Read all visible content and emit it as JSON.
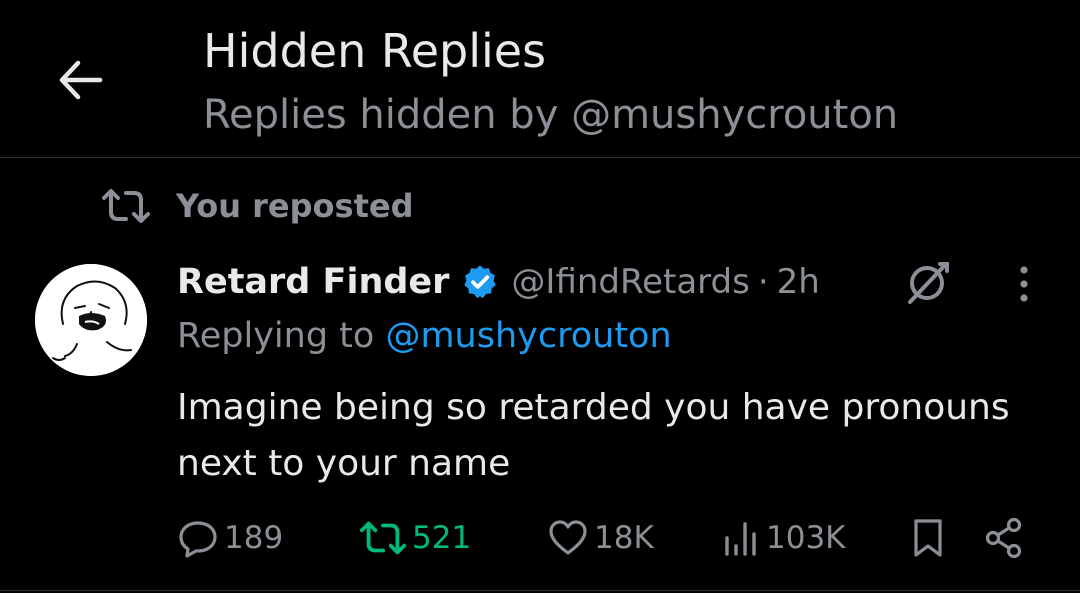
{
  "header": {
    "title": "Hidden Replies",
    "subtitle": "Replies hidden by @mushycrouton"
  },
  "repost_context": {
    "label": "You reposted"
  },
  "tweet": {
    "author_name": "Retard Finder",
    "handle": "@IfindRetards",
    "separator": "·",
    "time": "2h",
    "verified": true,
    "replying_prefix": "Replying to ",
    "replying_to": "@mushycrouton",
    "text": "Imagine being so retarded you have pronouns next to your name",
    "metrics": {
      "replies": "189",
      "reposts": "521",
      "likes": "18K",
      "views": "103K"
    }
  },
  "icons": {
    "back": "arrow-left-icon",
    "repost_context": "repost-icon",
    "verified": "verified-badge-icon",
    "grok": "grok-icon",
    "more": "more-vertical-icon",
    "reply": "reply-icon",
    "repost": "repost-icon",
    "like": "heart-icon",
    "views": "views-icon",
    "bookmark": "bookmark-icon",
    "share": "share-icon"
  },
  "colors": {
    "background": "#000000",
    "text_primary": "#e7e9ea",
    "text_secondary": "#8b9096",
    "accent": "#1d9bf0",
    "repost_active": "#00ba7c",
    "divider": "#2f3336"
  }
}
